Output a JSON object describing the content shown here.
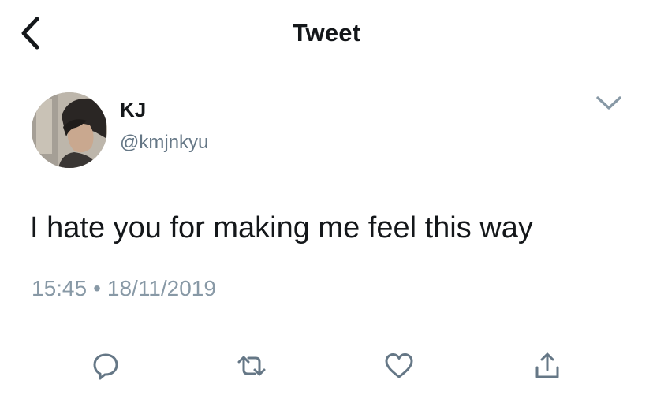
{
  "header": {
    "title": "Tweet",
    "back_icon": "chevron-left-icon"
  },
  "author": {
    "display_name": "KJ",
    "handle": "@kmjnkyu",
    "menu_icon": "chevron-down-icon"
  },
  "tweet": {
    "text": "I hate you for making me feel this way",
    "time": "15:45",
    "separator": "•",
    "date": "18/11/2019"
  },
  "actions": {
    "reply_icon": "reply-icon",
    "retweet_icon": "retweet-icon",
    "like_icon": "heart-icon",
    "share_icon": "share-icon"
  },
  "colors": {
    "text_primary": "#14171a",
    "text_secondary": "#657786",
    "meta_text": "#8899a6",
    "icon": "#657786",
    "divider": "#c8ccd0",
    "background": "#ffffff"
  }
}
